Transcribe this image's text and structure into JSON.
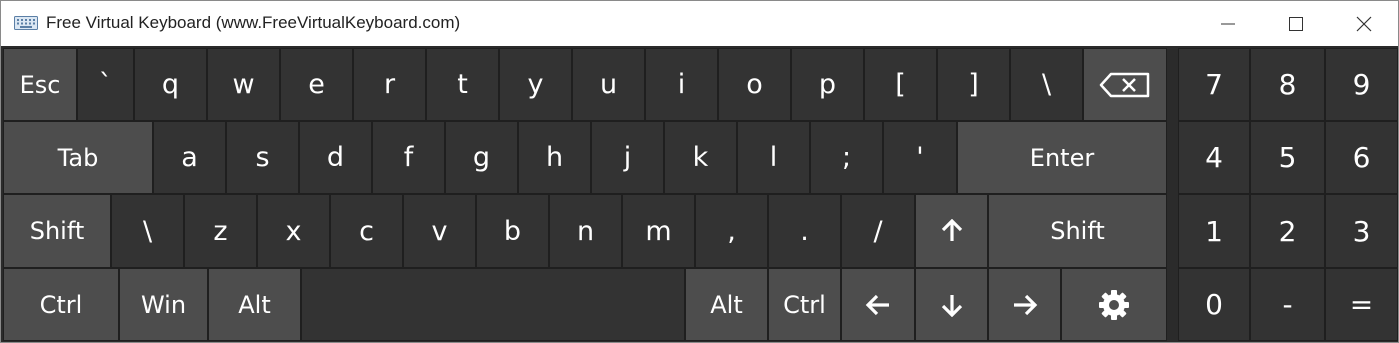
{
  "window": {
    "title": "Free Virtual Keyboard (www.FreeVirtualKeyboard.com)",
    "app_icon": "keyboard-icon",
    "controls": [
      "minimize-icon",
      "maximize-icon",
      "close-icon"
    ]
  },
  "colors": {
    "background": "#2b2b2b",
    "key_dark": "#333333",
    "key_modifier": "#4d4d4d",
    "text": "#ffffff",
    "titlebar": "#ffffff"
  },
  "keyboard": {
    "row1": {
      "esc": "Esc",
      "backtick": "`",
      "q": "q",
      "w": "w",
      "e": "e",
      "r": "r",
      "t": "t",
      "y": "y",
      "u": "u",
      "i": "i",
      "o": "o",
      "p": "p",
      "lbracket": "[",
      "rbracket": "]",
      "backslash": "\\",
      "backspace_icon": "backspace-icon"
    },
    "row2": {
      "tab": "Tab",
      "a": "a",
      "s": "s",
      "d": "d",
      "f": "f",
      "g": "g",
      "h": "h",
      "j": "j",
      "k": "k",
      "l": "l",
      "semicolon": ";",
      "quote": "'",
      "enter": "Enter"
    },
    "row3": {
      "shift_left": "Shift",
      "backslash": "\\",
      "z": "z",
      "x": "x",
      "c": "c",
      "v": "v",
      "b": "b",
      "n": "n",
      "m": "m",
      "comma": ",",
      "period": ".",
      "slash": "/",
      "up_icon": "arrow-up-icon",
      "shift_right": "Shift"
    },
    "row4": {
      "ctrl_left": "Ctrl",
      "win": "Win",
      "alt_left": "Alt",
      "alt_right": "Alt",
      "ctrl_right": "Ctrl",
      "left_icon": "arrow-left-icon",
      "down_icon": "arrow-down-icon",
      "right_icon": "arrow-right-icon",
      "settings_icon": "gear-icon"
    }
  },
  "numpad": {
    "n7": "7",
    "n8": "8",
    "n9": "9",
    "n4": "4",
    "n5": "5",
    "n6": "6",
    "n1": "1",
    "n2": "2",
    "n3": "3",
    "n0": "0",
    "minus": "-",
    "equals": "="
  }
}
